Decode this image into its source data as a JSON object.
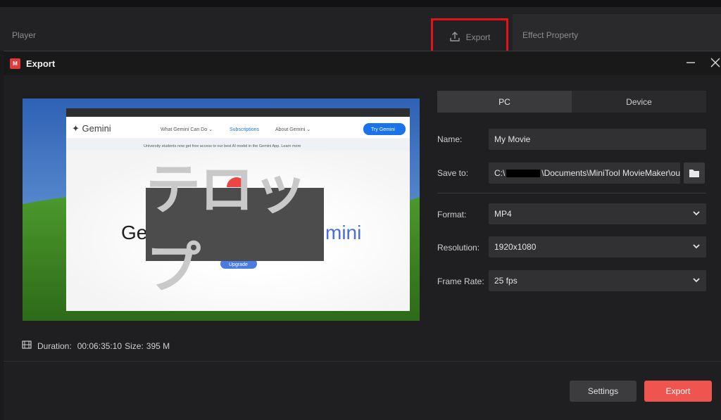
{
  "appbar": {
    "player_label": "Player",
    "export_tab_label": "Export",
    "effect_property_label": "Effect Property",
    "highlight_color": "#e0141b"
  },
  "dialog": {
    "title": "Export",
    "logo_text": "M",
    "preview": {
      "browser_brand": "Gemini",
      "nav_items": [
        "What Gemini Can Do",
        "Subscriptions",
        "About Gemini"
      ],
      "cta": "Try Gemini",
      "notice": "University students now get free access to our best AI model in the Gemini App. Learn more",
      "hero_left": "Ge",
      "hero_right": "mini",
      "upgrade": "Upgrade",
      "telop": "テロップ"
    },
    "duration_label": "Duration:",
    "duration_value": "00:06:35:10",
    "size_label": "Size:",
    "size_value": "395 M",
    "tabs": {
      "pc": "PC",
      "device": "Device"
    },
    "name_label": "Name:",
    "name_value": "My Movie",
    "save_label": "Save to:",
    "save_prefix": "C:\\",
    "save_suffix": "\\Documents\\MiniTool MovieMaker\\ou",
    "format_label": "Format:",
    "format_value": "MP4",
    "resolution_label": "Resolution:",
    "resolution_value": "1920x1080",
    "framerate_label": "Frame Rate:",
    "framerate_value": "25 fps",
    "settings_button": "Settings",
    "export_button": "Export",
    "accent_color": "#f0544f"
  }
}
